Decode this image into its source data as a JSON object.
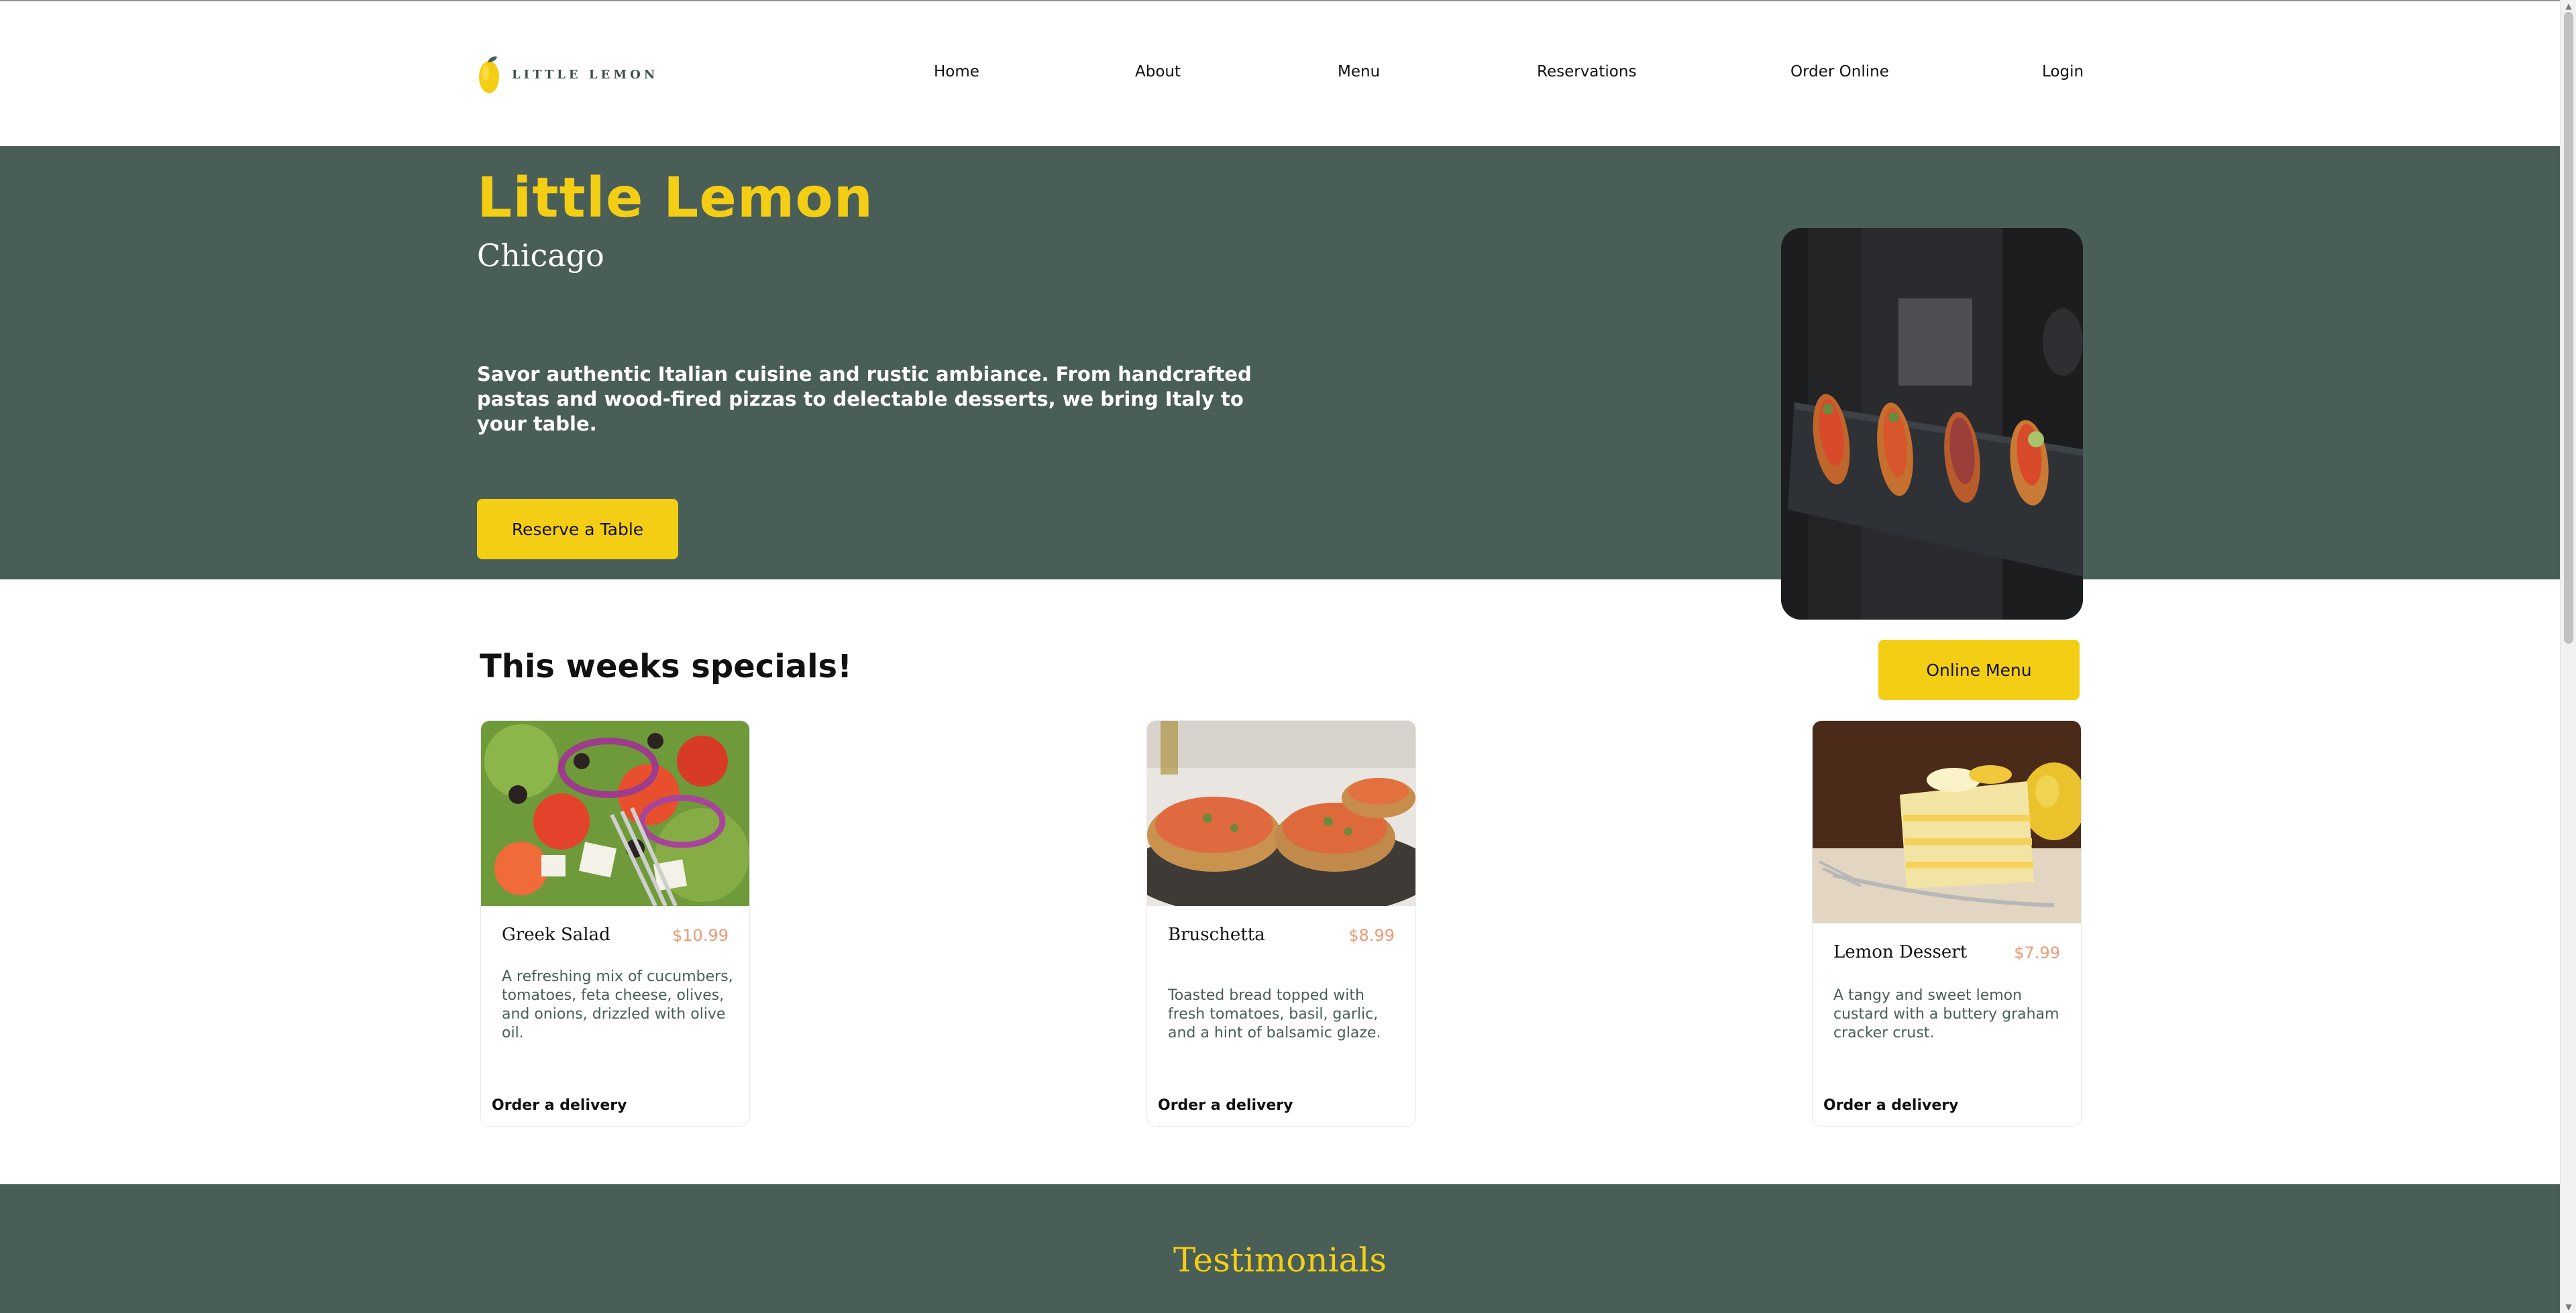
{
  "logo": {
    "text": "LITTLE LEMON",
    "icon": "lemon-icon"
  },
  "nav": {
    "items": [
      "Home",
      "About",
      "Menu",
      "Reservations",
      "Order Online",
      "Login"
    ]
  },
  "hero": {
    "title": "Little Lemon",
    "city": "Chicago",
    "description": "Savor authentic Italian cuisine and rustic ambiance. From handcrafted pastas and wood-fired pizzas to delectable desserts, we bring Italy to your table.",
    "button": "Reserve a Table",
    "image": "waiter-serving-bruschetta-photo"
  },
  "specials": {
    "title": "This weeks specials!",
    "menu_button": "Online Menu",
    "items": [
      {
        "name": "Greek Salad",
        "price": "$10.99",
        "description": "A refreshing mix of cucumbers, tomatoes, feta cheese, olives, and onions, drizzled with olive oil.",
        "order": "Order a delivery",
        "image": "greek-salad-photo"
      },
      {
        "name": "Bruschetta",
        "price": "$8.99",
        "description": "Toasted bread topped with fresh tomatoes, basil, garlic, and a hint of balsamic glaze.",
        "order": "Order a delivery",
        "image": "bruschetta-photo"
      },
      {
        "name": "Lemon Dessert",
        "price": "$7.99",
        "description": "A tangy and sweet lemon custard with a buttery graham cracker crust.",
        "order": "Order a delivery",
        "image": "lemon-dessert-photo"
      }
    ]
  },
  "testimonials": {
    "title": "Testimonials"
  },
  "colors": {
    "primary_green": "#495e57",
    "primary_yellow": "#f4ce14",
    "price_orange": "#ee9972",
    "background": "#ffffff"
  }
}
